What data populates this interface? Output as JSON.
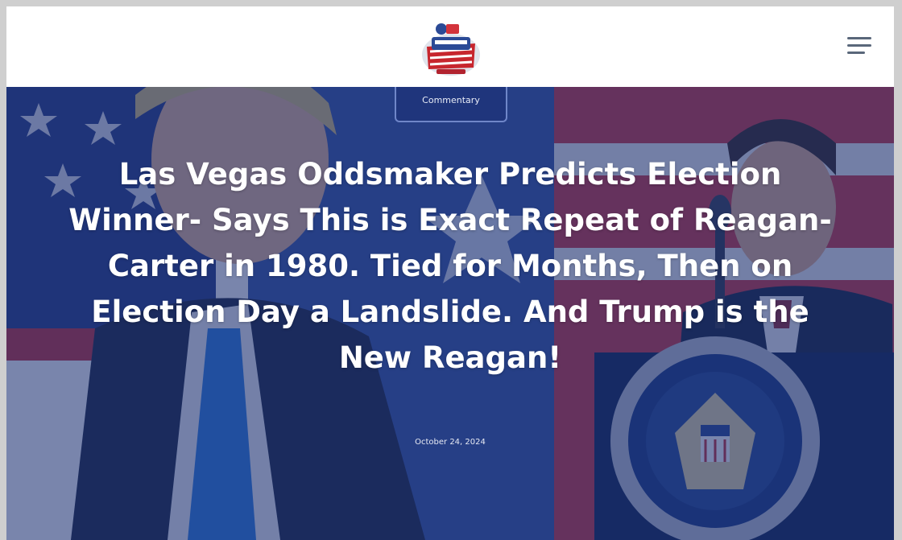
{
  "header": {
    "logo_icon": "america-logo-icon",
    "menu_icon": "hamburger-menu-icon"
  },
  "hero": {
    "category": "Commentary",
    "title": "Las Vegas Oddsmaker Predicts Election Winner- Says This is Exact Repeat of Reagan-Carter in 1980. Tied for Months, Then on Election Day a Landslide. And Trump is the New Reagan!",
    "date": "October 24, 2024",
    "overlay_color": "#182d70"
  },
  "colors": {
    "flag_red": "#b2232f",
    "flag_blue": "#1f3a7a",
    "menu_icon": "#59677a"
  }
}
